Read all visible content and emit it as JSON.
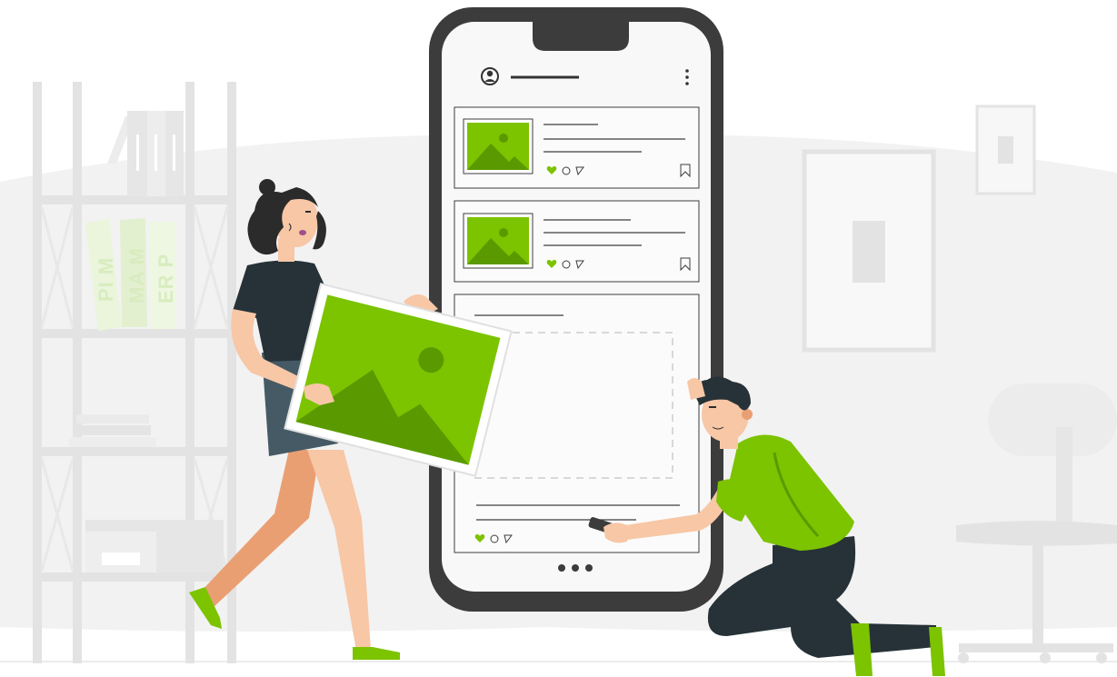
{
  "colors": {
    "accent_green": "#7cc300",
    "accent_green_dark": "#5a9a00",
    "phone_frame": "#3c3c3c",
    "phone_screen": "#f8f8f8",
    "background_shape": "#f2f2f2",
    "furniture_gray": "#e3e3e3",
    "skin": "#f7c7a6",
    "skin_shade": "#ea9f73",
    "hair_dark": "#2b2b2b",
    "pants_dark": "#263238"
  },
  "shelf": {
    "binders": [
      {
        "label": "PI M"
      },
      {
        "label": "MA M"
      },
      {
        "label": "ER P"
      }
    ]
  },
  "phone": {
    "header": {
      "profile_icon": "user-circle-icon",
      "menu_icon": "vertical-dots-icon"
    },
    "posts": [
      {
        "image_icon": "landscape-image-icon",
        "actions": [
          "heart-icon",
          "comment-icon",
          "send-icon"
        ],
        "bookmark_icon": "bookmark-icon"
      },
      {
        "image_icon": "landscape-image-icon",
        "actions": [
          "heart-icon",
          "comment-icon",
          "send-icon"
        ],
        "bookmark_icon": "bookmark-icon"
      }
    ],
    "placeholder_post": {
      "actions": [
        "heart-icon",
        "comment-icon",
        "send-icon"
      ]
    },
    "pagination_icon": "three-dots-icon"
  },
  "characters": {
    "woman_holding_picture": "landscape-image-icon",
    "man_placing_post": "phone-icon"
  }
}
